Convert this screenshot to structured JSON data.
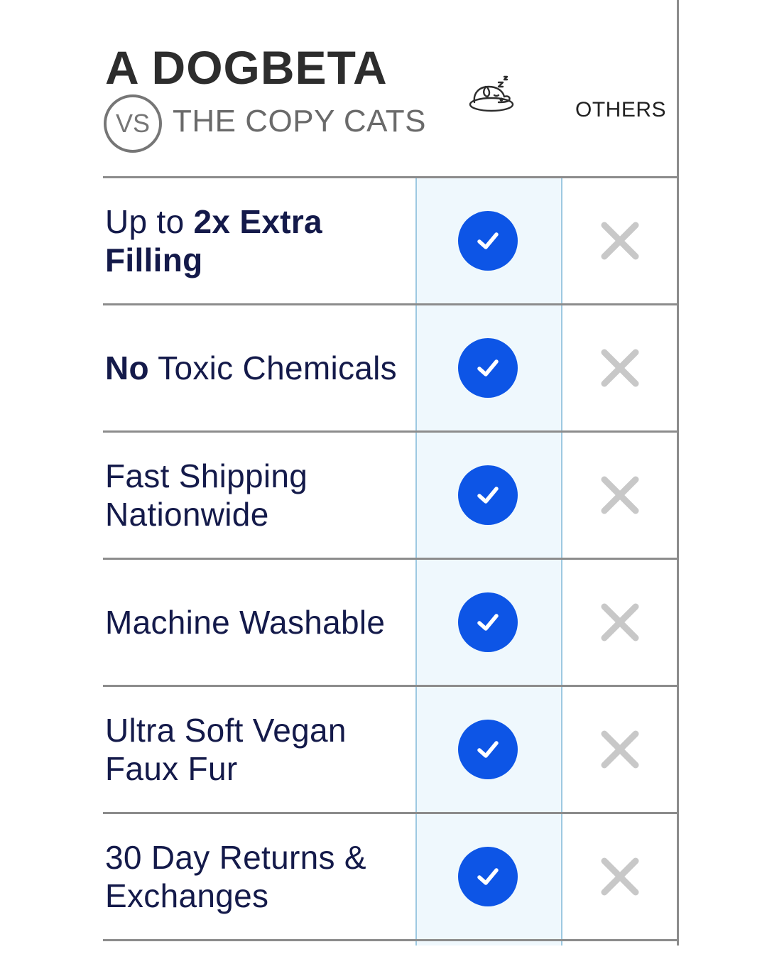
{
  "header": {
    "title": "A DOGBETA",
    "vs_label": "VS",
    "subtitle": "THE COPY CATS",
    "brand_icon": "sleeping-dog-icon",
    "others_label": "OTHERS"
  },
  "colors": {
    "check_blue": "#0d55e6",
    "highlight_bg": "#eff8fd",
    "highlight_border": "#9dc9e1",
    "cross_gray": "#c8c8c8",
    "text_navy": "#141a4a"
  },
  "rows": [
    {
      "parts": [
        {
          "text": "Up to ",
          "bold": false
        },
        {
          "text": "2x Extra Filling",
          "bold": true
        }
      ],
      "dogbeta": "check",
      "others": "cross"
    },
    {
      "parts": [
        {
          "text": "No",
          "bold": true
        },
        {
          "text": " Toxic Chemicals",
          "bold": false
        }
      ],
      "dogbeta": "check",
      "others": "cross"
    },
    {
      "parts": [
        {
          "text": "Fast Shipping Nationwide",
          "bold": false
        }
      ],
      "dogbeta": "check",
      "others": "cross"
    },
    {
      "parts": [
        {
          "text": "Machine Washable",
          "bold": false
        }
      ],
      "dogbeta": "check",
      "others": "cross"
    },
    {
      "parts": [
        {
          "text": "Ultra Soft Vegan Faux Fur",
          "bold": false
        }
      ],
      "dogbeta": "check",
      "others": "cross"
    },
    {
      "parts": [
        {
          "text": "30 Day Returns & Exchanges",
          "bold": false
        }
      ],
      "dogbeta": "check",
      "others": "cross"
    }
  ]
}
